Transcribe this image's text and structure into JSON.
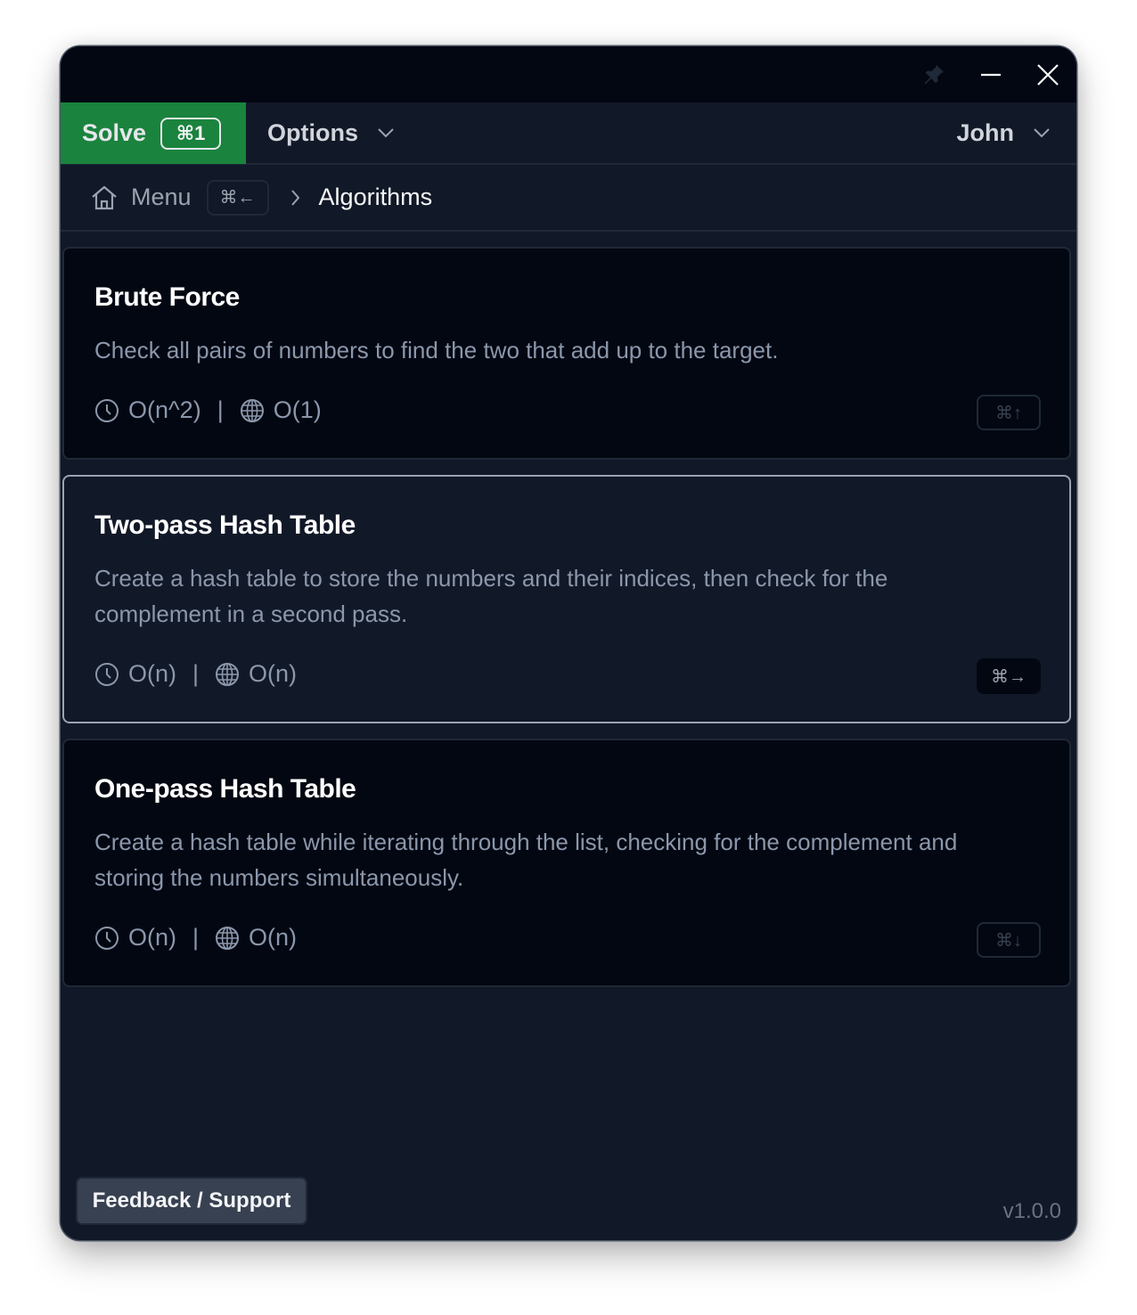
{
  "window": {
    "controls": {
      "pin": "pin-icon",
      "minimize": "minimize-icon",
      "close": "close-icon"
    }
  },
  "menubar": {
    "solve_label": "Solve",
    "solve_shortcut": "⌘1",
    "options_label": "Options",
    "user_label": "John",
    "accent_color": "#1a833d"
  },
  "breadcrumb": {
    "home_icon": "home-icon",
    "menu_label": "Menu",
    "menu_shortcut": "⌘←",
    "current": "Algorithms"
  },
  "cards": [
    {
      "title": "Brute Force",
      "description": "Check all pairs of numbers to find the two that add up to the target.",
      "time_complexity": "O(n^2)",
      "space_complexity": "O(1)",
      "separator": "|",
      "shortcut": "⌘↑",
      "selected": false
    },
    {
      "title": "Two-pass Hash Table",
      "description": "Create a hash table to store the numbers and their indices, then check for the complement in a second pass.",
      "time_complexity": "O(n)",
      "space_complexity": "O(n)",
      "separator": "|",
      "shortcut": "⌘→",
      "selected": true
    },
    {
      "title": "One-pass Hash Table",
      "description": "Create a hash table while iterating through the list, checking for the complement and storing the numbers simultaneously.",
      "time_complexity": "O(n)",
      "space_complexity": "O(n)",
      "separator": "|",
      "shortcut": "⌘↓",
      "selected": false
    }
  ],
  "footer": {
    "feedback_label": "Feedback / Support",
    "version": "v1.0.0"
  }
}
